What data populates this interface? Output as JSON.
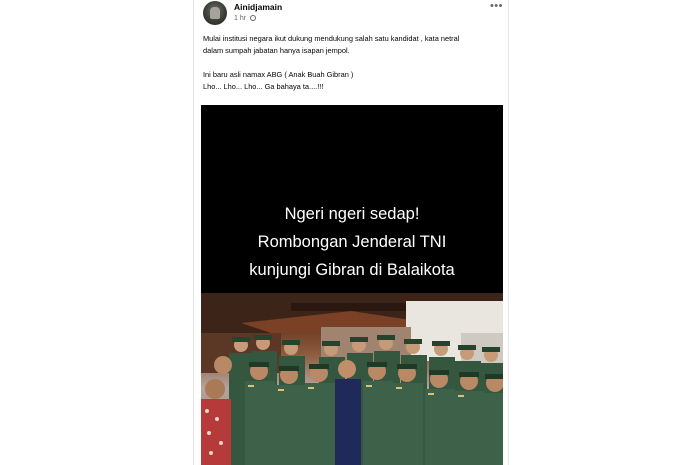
{
  "post": {
    "author": "Ainidjamain",
    "time": "1 hr",
    "menu_icon": "more-options-icon",
    "text_lines": [
      "Mulai institusi negara ikut dukung mendukung salah satu kandidat ,  kata netral",
      "dalam sumpah jabatan hanya isapan jempol.",
      "",
      "Ini baru asli namax ABG ( Anak Buah Gibran )",
      "Lho... Lho... Lho... Ga bahaya ta....!!!"
    ]
  },
  "video": {
    "caption_lines": [
      "Ngeri ngeri sedap!",
      "Rombongan Jenderal TNI",
      "kunjungi Gibran di Balaikota"
    ]
  },
  "colors": {
    "text": "#050505",
    "meta": "#65676b",
    "uniform": "#2f4a35",
    "suit": "#1f2a5a"
  }
}
